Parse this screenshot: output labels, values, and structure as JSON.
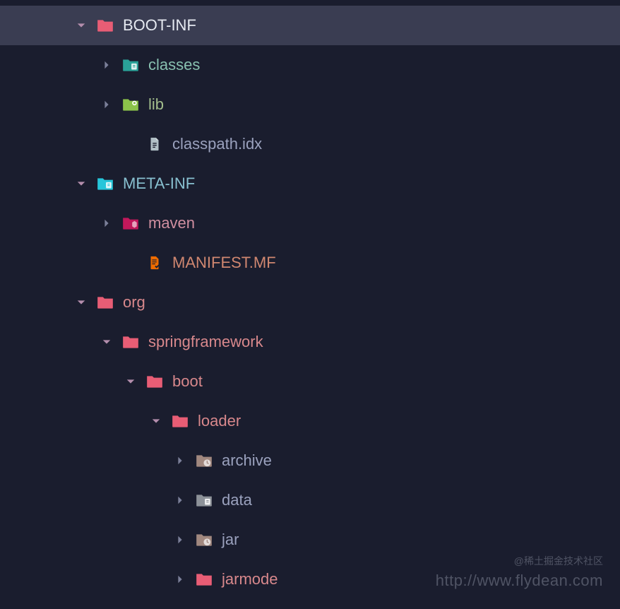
{
  "tree": {
    "boot_inf": "BOOT-INF",
    "classes": "classes",
    "lib": "lib",
    "classpath_idx": "classpath.idx",
    "meta_inf": "META-INF",
    "maven": "maven",
    "manifest_mf": "MANIFEST.MF",
    "org": "org",
    "springframework": "springframework",
    "boot": "boot",
    "loader": "loader",
    "archive": "archive",
    "data": "data",
    "jar": "jar",
    "jarmode": "jarmode"
  },
  "watermark": {
    "attribution": "@稀土掘金技术社区",
    "url": "http://www.flydean.com"
  },
  "colors": {
    "folder_red": "#e85d75",
    "folder_teal": "#2aa198",
    "folder_green": "#8bc34a",
    "folder_cyan": "#26c6da",
    "folder_pink": "#c2185b",
    "folder_orange": "#ef6c00",
    "folder_tan": "#a1887f",
    "folder_darkgray": "#6d6d6d",
    "file_gray": "#b0bec5"
  }
}
